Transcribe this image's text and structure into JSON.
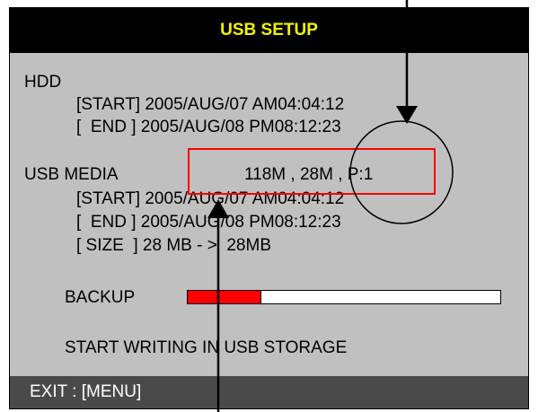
{
  "dialog": {
    "title": "USB SETUP",
    "title_color": "#f4f400",
    "background": "#c0c0c0"
  },
  "hdd": {
    "label": "HDD",
    "start": "[START] 2005/AUG/07 AM04:04:12",
    "end": "[  END ] 2005/AUG/08 PM08:12:23"
  },
  "usb_media": {
    "label": "USB MEDIA",
    "summary": "118M , 28M , P:1",
    "start": "[START] 2005/AUG/07 AM04:04:12",
    "end": "[  END ] 2005/AUG/08 PM08:12:23",
    "size": "[ SIZE  ] 28 MB - >  28MB"
  },
  "backup": {
    "label": "BACKUP",
    "progress": 0.235,
    "fill_color": "#ff0000"
  },
  "status": {
    "message": "START WRITING IN USB STORAGE"
  },
  "footer": {
    "exit_label": "EXIT : [MENU]"
  }
}
